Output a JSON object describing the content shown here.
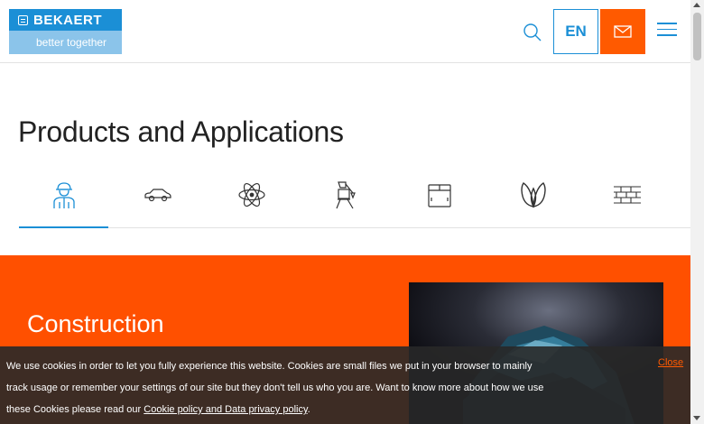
{
  "header": {
    "logo_name": "BEKAERT",
    "logo_tagline": "better together",
    "language": "EN"
  },
  "page": {
    "title": "Products and Applications"
  },
  "tabs": [
    {
      "icon": "worker-icon",
      "active": true
    },
    {
      "icon": "car-icon",
      "active": false
    },
    {
      "icon": "atom-icon",
      "active": false
    },
    {
      "icon": "crane-icon",
      "active": false
    },
    {
      "icon": "box-icon",
      "active": false
    },
    {
      "icon": "leaf-icon",
      "active": false
    },
    {
      "icon": "bricks-icon",
      "active": false
    }
  ],
  "hero": {
    "title": "Construction"
  },
  "cookie": {
    "text": "We use cookies in order to let you fully experience this website. Cookies are small files we put in your browser to mainly track usage or remember your settings of our site but they don't tell us who you are. Want to know more about how we use these Cookies please read our ",
    "link": "Cookie policy and Data privacy policy",
    "suffix": ".",
    "close": "Close"
  },
  "colors": {
    "brand_blue": "#1b8fd6",
    "accent_orange": "#ff5000"
  }
}
